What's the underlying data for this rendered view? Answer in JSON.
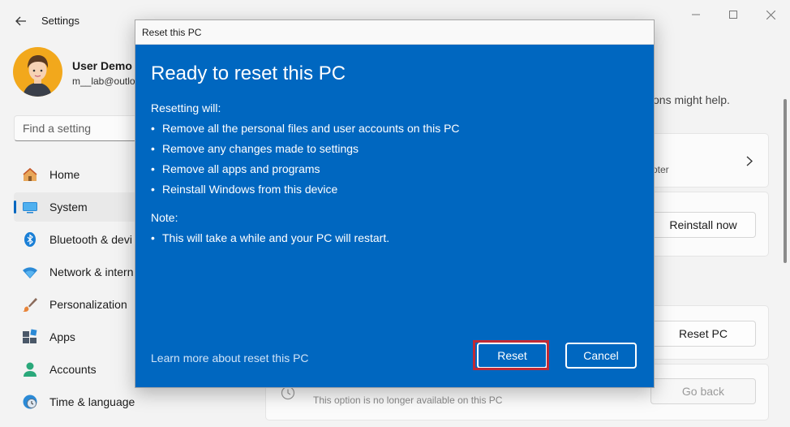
{
  "window": {
    "app_title": "Settings",
    "controls": {
      "minimize": "—",
      "maximize": "☐",
      "close": "✕"
    }
  },
  "user": {
    "name": "User Demo",
    "email": "m__lab@outlo"
  },
  "search": {
    "placeholder": "Find a setting"
  },
  "nav": [
    {
      "label": "Home",
      "icon": "home-icon"
    },
    {
      "label": "System",
      "icon": "system-icon",
      "selected": true
    },
    {
      "label": "Bluetooth & devi",
      "icon": "bluetooth-icon"
    },
    {
      "label": "Network & intern",
      "icon": "network-icon"
    },
    {
      "label": "Personalization",
      "icon": "brush-icon"
    },
    {
      "label": "Apps",
      "icon": "apps-icon"
    },
    {
      "label": "Accounts",
      "icon": "accounts-icon"
    },
    {
      "label": "Time & language",
      "icon": "globe-clock-icon"
    }
  ],
  "background": {
    "hint_text": "ons might help.",
    "troubleshooter_text": "oter",
    "reinstall_label": "Reinstall now",
    "reset_pc_label": "Reset PC",
    "go_back_label": "Go back",
    "go_back_note": "This option is no longer available on this PC"
  },
  "dialog": {
    "title": "Reset this PC",
    "heading": "Ready to reset this PC",
    "resetting_label": "Resetting will:",
    "bullets": [
      "Remove all the personal files and user accounts on this PC",
      "Remove any changes made to settings",
      "Remove all apps and programs",
      "Reinstall Windows from this device"
    ],
    "note_label": "Note:",
    "note_bullets": [
      "This will take a while and your PC will restart."
    ],
    "learn_more": "Learn more about reset this PC",
    "reset_button": "Reset",
    "cancel_button": "Cancel"
  },
  "colors": {
    "dialog_blue": "#0067c0",
    "highlight_red": "#c12a35",
    "accent": "#0067c0"
  }
}
